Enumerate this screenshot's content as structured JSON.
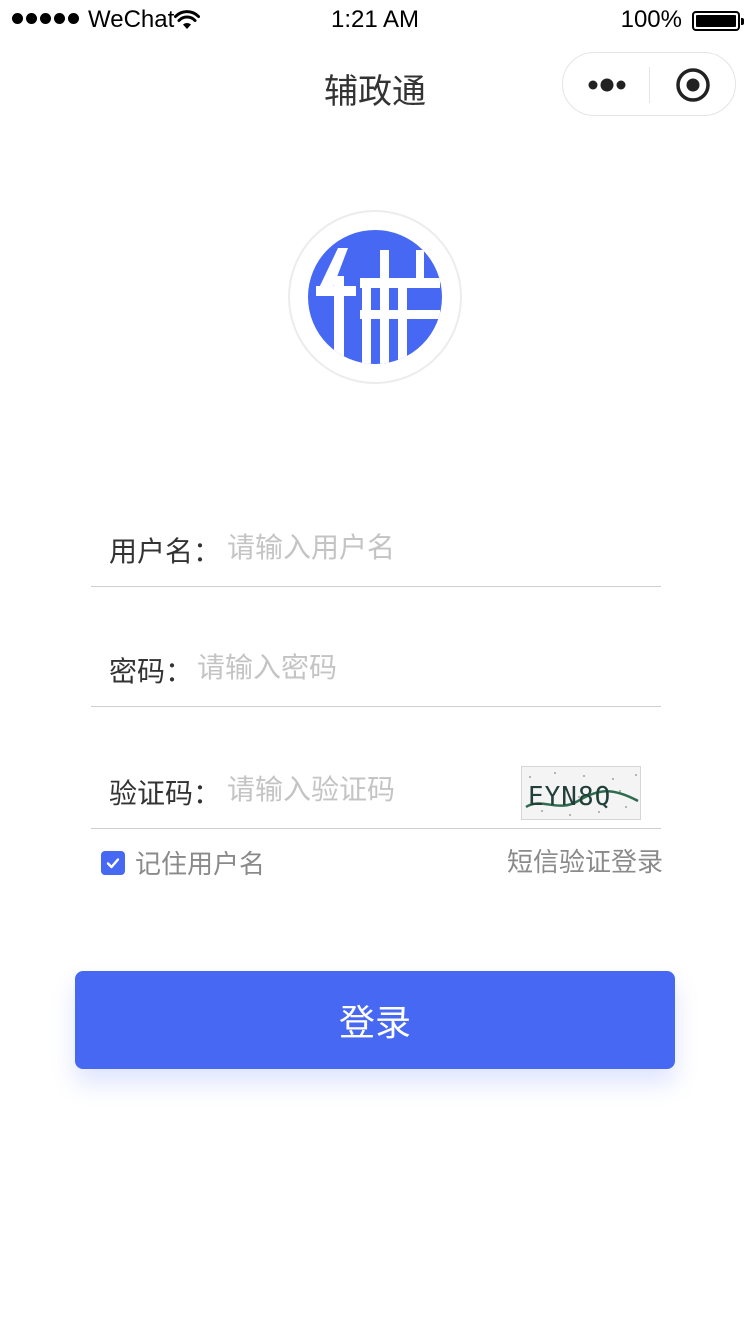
{
  "status_bar": {
    "carrier": "WeChat",
    "time": "1:21 AM",
    "battery_percent": "100%",
    "signal_bars": 5,
    "wifi_icon": "wifi-icon",
    "battery_icon": "battery-icon"
  },
  "nav": {
    "title": "辅政通",
    "more_icon": "more-icon",
    "close_icon": "close-circle-icon"
  },
  "logo": {
    "text": "辅",
    "icon": "app-logo",
    "color": "#4768f3"
  },
  "form": {
    "username": {
      "label": "用户名：",
      "placeholder": "请输入用户名",
      "value": ""
    },
    "password": {
      "label": "密码：",
      "placeholder": "请输入密码",
      "value": ""
    },
    "captcha": {
      "label": "验证码：",
      "placeholder": "请输入验证码",
      "value": "",
      "image_text": "EYN8Q"
    },
    "remember": {
      "label": "记住用户名",
      "checked": true
    },
    "sms_login": "短信验证登录"
  },
  "login_button": {
    "label": "登录"
  },
  "colors": {
    "accent": "#4768f3",
    "placeholder": "#c4c4c4",
    "secondary_text": "#8a8a8a",
    "divider": "#cfcfcf"
  }
}
